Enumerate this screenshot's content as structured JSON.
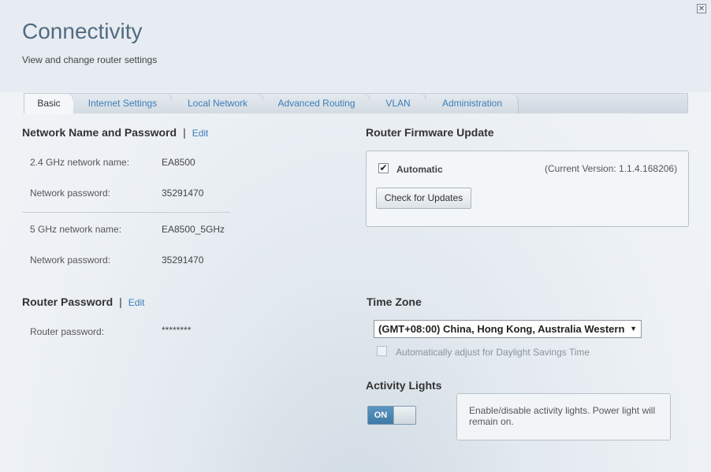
{
  "header": {
    "title": "Connectivity",
    "subtitle": "View and change router settings",
    "close_icon": "close-icon"
  },
  "tabs": [
    {
      "label": "Basic",
      "active": true
    },
    {
      "label": "Internet Settings",
      "active": false
    },
    {
      "label": "Local Network",
      "active": false
    },
    {
      "label": "Advanced Routing",
      "active": false
    },
    {
      "label": "VLAN",
      "active": false
    },
    {
      "label": "Administration",
      "active": false
    }
  ],
  "network": {
    "title": "Network Name and Password",
    "separator": "|",
    "edit_label": "Edit",
    "rows": [
      {
        "label": "2.4 GHz network name:",
        "value": "EA8500"
      },
      {
        "label": "Network password:",
        "value": "35291470"
      },
      {
        "label": "5 GHz network name:",
        "value": "EA8500_5GHz"
      },
      {
        "label": "Network password:",
        "value": "35291470"
      }
    ]
  },
  "router_password": {
    "title": "Router Password",
    "separator": "|",
    "edit_label": "Edit",
    "label": "Router password:",
    "value": "********"
  },
  "firmware": {
    "title": "Router Firmware Update",
    "automatic_label": "Automatic",
    "automatic_checked": true,
    "check_mark": "✔",
    "current_version": "(Current Version: 1.1.4.168206)",
    "check_button": "Check for Updates"
  },
  "timezone": {
    "title": "Time Zone",
    "selected": "(GMT+08:00) China, Hong Kong, Australia Western",
    "dropdown_arrow": "▼",
    "dst_label": "Automatically adjust for Daylight Savings Time",
    "dst_checked": false
  },
  "activity_lights": {
    "title": "Activity Lights",
    "toggle_state": "ON",
    "info": "Enable/disable activity lights. Power light will remain on."
  },
  "colors": {
    "accent": "#3c7db8",
    "title": "#536b80",
    "toggle_on": "#4a86b2"
  }
}
